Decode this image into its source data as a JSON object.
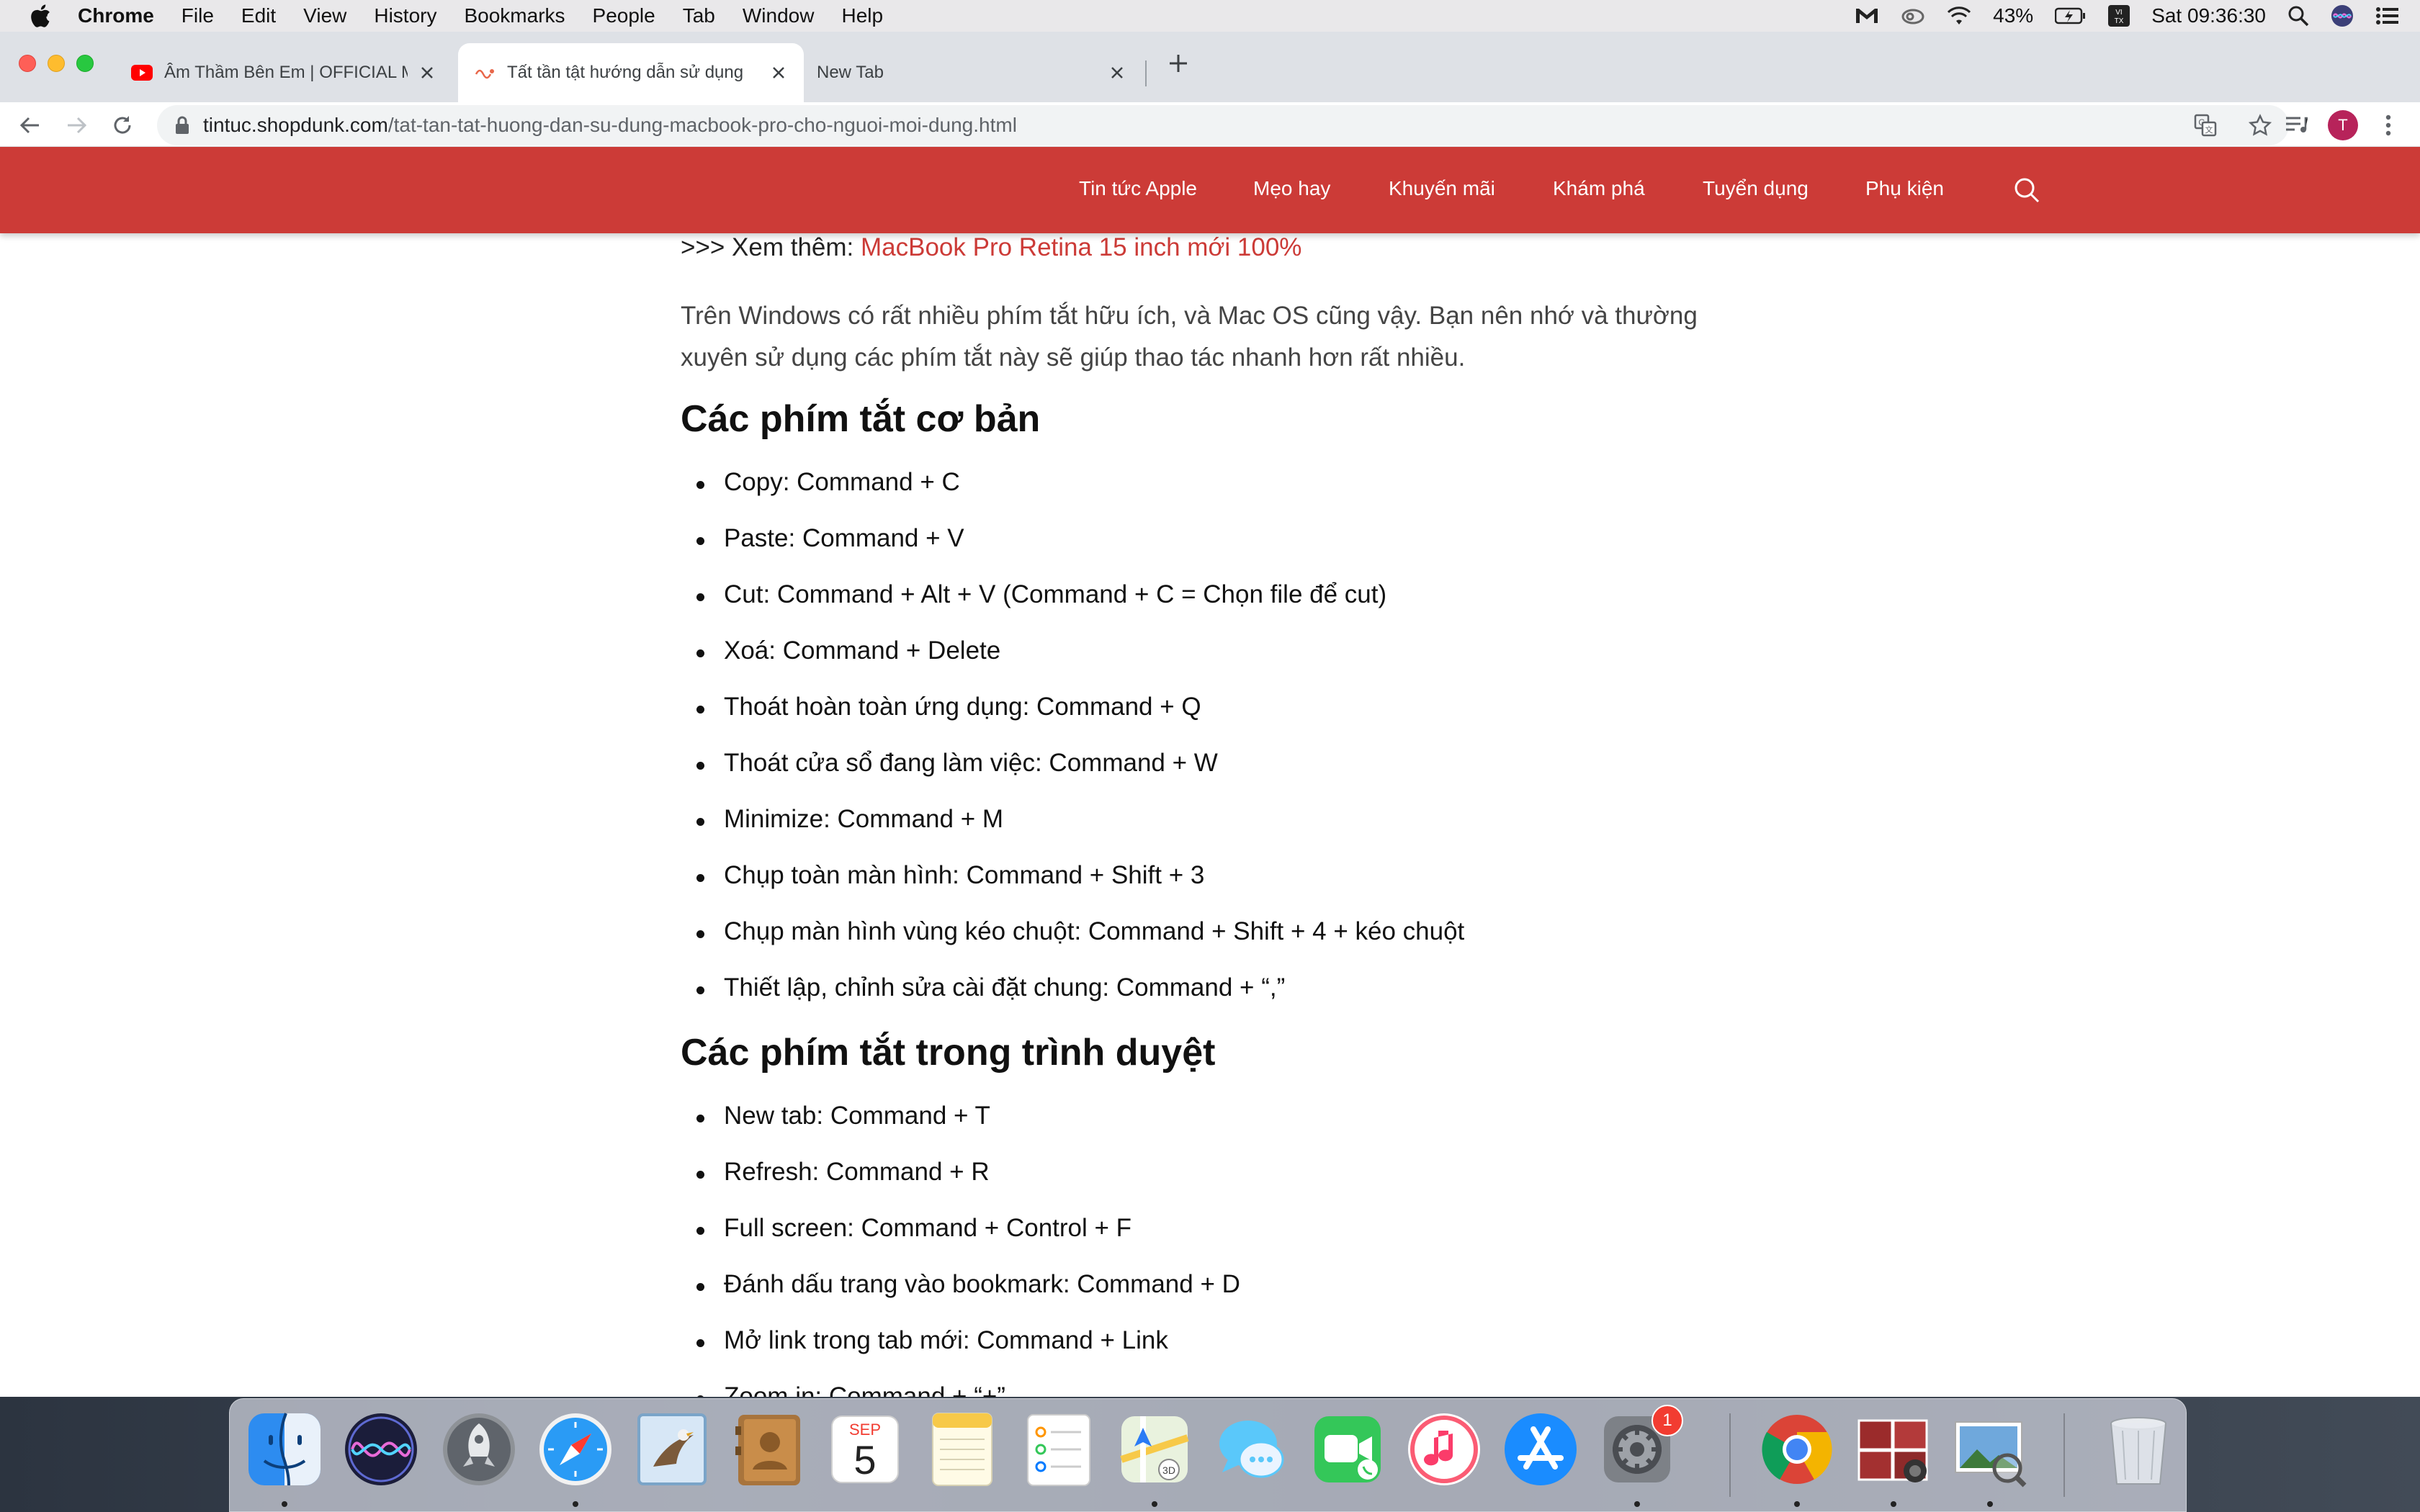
{
  "menubar": {
    "app_name": "Chrome",
    "items": [
      "File",
      "Edit",
      "View",
      "History",
      "Bookmarks",
      "People",
      "Tab",
      "Window",
      "Help"
    ],
    "battery": "43%",
    "clock": "Sat 09:36:30",
    "input_source": "VI TX"
  },
  "tabs": [
    {
      "title": "Âm Thầm Bên Em | OFFICIAL M",
      "favicon": "youtube-icon",
      "active": false
    },
    {
      "title": "Tất tần tật hướng dẫn sử dụng",
      "favicon": "shopdunk-icon",
      "active": true
    },
    {
      "title": "New Tab",
      "favicon": "",
      "active": false
    }
  ],
  "omnibox": {
    "host": "tintuc.shopdunk.com",
    "path": "/tat-tan-tat-huong-dan-su-dung-macbook-pro-cho-nguoi-moi-dung.html"
  },
  "profile_initial": "T",
  "site_nav": {
    "items": [
      "Tin tức Apple",
      "Mẹo hay",
      "Khuyến mãi",
      "Khám phá",
      "Tuyển dụng",
      "Phụ kiện"
    ]
  },
  "article": {
    "see_more_prefix": ">>> Xem thêm: ",
    "see_more_link": "MacBook Pro Retina 15 inch mới 100%",
    "intro": "Trên Windows có rất nhiều phím tắt hữu ích, và Mac OS cũng vậy. Bạn nên nhớ và thường xuyên sử dụng các phím tắt này sẽ giúp thao tác nhanh hơn rất nhiều.",
    "section1_title": "Các phím tắt cơ bản",
    "section1_items": [
      "Copy: Command + C",
      "Paste: Command + V",
      "Cut: Command + Alt + V (Command + C = Chọn file để cut)",
      "Xoá:  Command + Delete",
      "Thoát hoàn toàn ứng dụng:  Command + Q",
      "Thoát cửa sổ đang làm việc: Command + W",
      "Minimize: Command + M",
      "Chụp toàn màn hình: Command + Shift + 3",
      "Chụp màn hình vùng kéo chuột: Command + Shift + 4 + kéo chuột",
      "Thiết lập, chỉnh sửa cài đặt chung: Command + “,”"
    ],
    "section2_title": "Các phím tắt trong trình duyệt",
    "section2_items": [
      "New tab: Command + T",
      "Refresh: Command + R",
      "Full screen: Command + Control + F",
      "Đánh dấu trang vào bookmark: Command + D",
      "Mở link trong tab mới: Command + Link",
      "Zoom in: Command + “+”"
    ]
  },
  "dock": {
    "apps": [
      "finder",
      "siri",
      "launchpad",
      "safari",
      "mail",
      "contacts",
      "calendar",
      "notes",
      "reminders",
      "maps",
      "messages",
      "facetime",
      "itunes",
      "app-store",
      "system-preferences",
      "chrome",
      "photo-booth",
      "preview",
      "trash"
    ],
    "calendar_month": "SEP",
    "calendar_day": "5",
    "system_prefs_badge": "1"
  }
}
